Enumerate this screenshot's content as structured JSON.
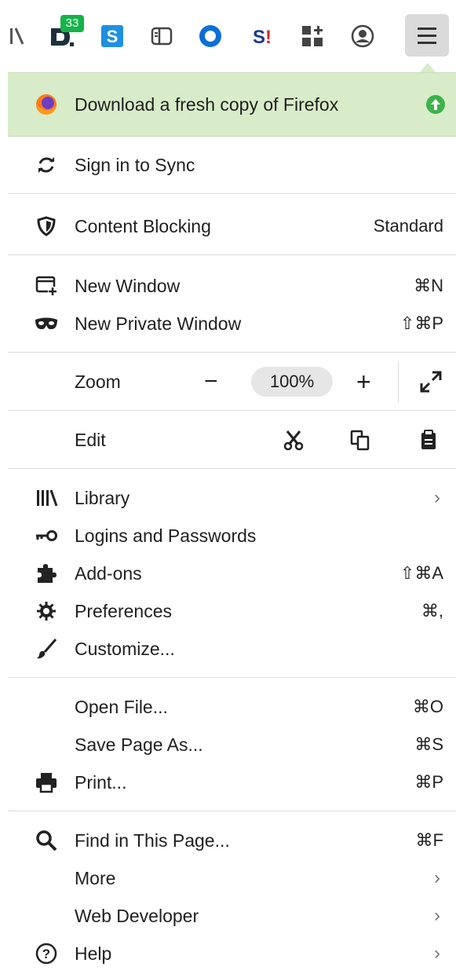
{
  "toolbar": {
    "icons": [
      "library-icon",
      "dashlane-icon",
      "simplenote-icon",
      "sidebar-icon",
      "onepassword-icon",
      "sedit-icon",
      "apps-icon",
      "account-icon"
    ],
    "badge_count": "33",
    "menu_icon": "hamburger-menu-icon"
  },
  "banner": {
    "label": "Download a fresh copy of Firefox",
    "icon": "firefox-icon",
    "action_icon": "update-arrow-icon"
  },
  "sync": {
    "label": "Sign in to Sync"
  },
  "content_blocking": {
    "label": "Content Blocking",
    "value": "Standard"
  },
  "new_window": {
    "label": "New Window",
    "shortcut": "⌘N"
  },
  "new_private_window": {
    "label": "New Private Window",
    "shortcut": "⇧⌘P"
  },
  "zoom": {
    "label": "Zoom",
    "minus": "−",
    "value": "100%",
    "plus": "+"
  },
  "edit": {
    "label": "Edit"
  },
  "library": {
    "label": "Library",
    "chevron": "›"
  },
  "logins": {
    "label": "Logins and Passwords"
  },
  "addons": {
    "label": "Add-ons",
    "shortcut": "⇧⌘A"
  },
  "preferences": {
    "label": "Preferences",
    "shortcut": "⌘,"
  },
  "customize": {
    "label": "Customize..."
  },
  "open_file": {
    "label": "Open File...",
    "shortcut": "⌘O"
  },
  "save_page": {
    "label": "Save Page As...",
    "shortcut": "⌘S"
  },
  "print": {
    "label": "Print...",
    "shortcut": "⌘P"
  },
  "find": {
    "label": "Find in This Page...",
    "shortcut": "⌘F"
  },
  "more": {
    "label": "More",
    "chevron": "›"
  },
  "web_developer": {
    "label": "Web Developer",
    "chevron": "›"
  },
  "help": {
    "label": "Help",
    "chevron": "›"
  }
}
